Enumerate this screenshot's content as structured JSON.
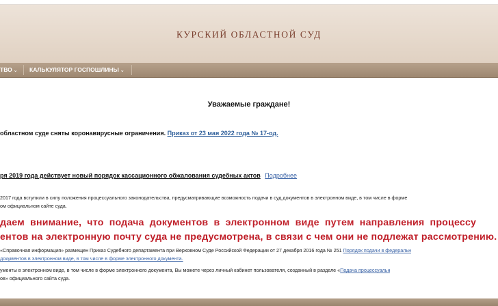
{
  "site": {
    "title": "КУРСКИЙ ОБЛАСТНОЙ СУД"
  },
  "nav": {
    "items": [
      {
        "label": "ТВО",
        "caret": "⌄"
      },
      {
        "label": "КАЛЬКУЛЯТОР ГОСПОШЛИНЫ",
        "caret": "⌄"
      }
    ]
  },
  "content": {
    "greeting": "Уважаемые граждане!",
    "notice_covid": {
      "text": "областном суде сняты коронавирусные ограничения.",
      "link": "Приказ от 23 мая 2022 года № 17-од."
    },
    "notice_cassation": {
      "text": "ря 2019 года действует новый порядок кассационного обжалования судебных актов",
      "link": "Подробнее"
    },
    "para1": {
      "line1": "2017 года вступили в силу положения процессуального законодательства, предусматривающие возможность подачи в суд документов в электронном виде, в том числе в форме",
      "line2": "ом официальном сайте суда."
    },
    "warning": {
      "line1": "даем внимание, что подача документов в электронном виде путем направления процессу",
      "line2": "ентов на электронную почту суда не предусмотрена, в связи с чем они не подлежат рассмотрению."
    },
    "para2": {
      "line1_text": "«Справочная информация» размещен Приказ Судебного департамента при Верховном Суде Российской Федерации от 27 декабря 2016 года № 251",
      "line1_link": "Порядок подачи в федеральн",
      "line2_link": "документов в электронном виде, в том числе в форме электронного документа."
    },
    "para3": {
      "line1_text": "ументы в электронном виде, в том числе в форме электронного документа, Вы можете через личный кабинет пользователя, созданный в разделе «",
      "line1_link": "Подача процессуальн",
      "line2_text": "ов» официального сайта суда."
    }
  },
  "colors": {
    "banner": "#e6d9cc",
    "title": "#7a3f2e",
    "navbar": "#a8927b",
    "warning": "#c0202a",
    "link": "#3a63a6"
  }
}
